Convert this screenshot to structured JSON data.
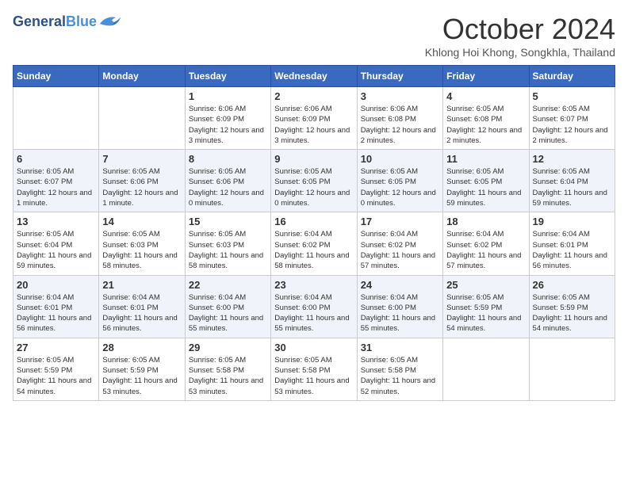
{
  "header": {
    "logo_line1": "General",
    "logo_line2": "Blue",
    "month_title": "October 2024",
    "subtitle": "Khlong Hoi Khong, Songkhla, Thailand"
  },
  "weekdays": [
    "Sunday",
    "Monday",
    "Tuesday",
    "Wednesday",
    "Thursday",
    "Friday",
    "Saturday"
  ],
  "weeks": [
    [
      {
        "day": "",
        "info": ""
      },
      {
        "day": "",
        "info": ""
      },
      {
        "day": "1",
        "info": "Sunrise: 6:06 AM\nSunset: 6:09 PM\nDaylight: 12 hours and 3 minutes."
      },
      {
        "day": "2",
        "info": "Sunrise: 6:06 AM\nSunset: 6:09 PM\nDaylight: 12 hours and 3 minutes."
      },
      {
        "day": "3",
        "info": "Sunrise: 6:06 AM\nSunset: 6:08 PM\nDaylight: 12 hours and 2 minutes."
      },
      {
        "day": "4",
        "info": "Sunrise: 6:05 AM\nSunset: 6:08 PM\nDaylight: 12 hours and 2 minutes."
      },
      {
        "day": "5",
        "info": "Sunrise: 6:05 AM\nSunset: 6:07 PM\nDaylight: 12 hours and 2 minutes."
      }
    ],
    [
      {
        "day": "6",
        "info": "Sunrise: 6:05 AM\nSunset: 6:07 PM\nDaylight: 12 hours and 1 minute."
      },
      {
        "day": "7",
        "info": "Sunrise: 6:05 AM\nSunset: 6:06 PM\nDaylight: 12 hours and 1 minute."
      },
      {
        "day": "8",
        "info": "Sunrise: 6:05 AM\nSunset: 6:06 PM\nDaylight: 12 hours and 0 minutes."
      },
      {
        "day": "9",
        "info": "Sunrise: 6:05 AM\nSunset: 6:05 PM\nDaylight: 12 hours and 0 minutes."
      },
      {
        "day": "10",
        "info": "Sunrise: 6:05 AM\nSunset: 6:05 PM\nDaylight: 12 hours and 0 minutes."
      },
      {
        "day": "11",
        "info": "Sunrise: 6:05 AM\nSunset: 6:05 PM\nDaylight: 11 hours and 59 minutes."
      },
      {
        "day": "12",
        "info": "Sunrise: 6:05 AM\nSunset: 6:04 PM\nDaylight: 11 hours and 59 minutes."
      }
    ],
    [
      {
        "day": "13",
        "info": "Sunrise: 6:05 AM\nSunset: 6:04 PM\nDaylight: 11 hours and 59 minutes."
      },
      {
        "day": "14",
        "info": "Sunrise: 6:05 AM\nSunset: 6:03 PM\nDaylight: 11 hours and 58 minutes."
      },
      {
        "day": "15",
        "info": "Sunrise: 6:05 AM\nSunset: 6:03 PM\nDaylight: 11 hours and 58 minutes."
      },
      {
        "day": "16",
        "info": "Sunrise: 6:04 AM\nSunset: 6:02 PM\nDaylight: 11 hours and 58 minutes."
      },
      {
        "day": "17",
        "info": "Sunrise: 6:04 AM\nSunset: 6:02 PM\nDaylight: 11 hours and 57 minutes."
      },
      {
        "day": "18",
        "info": "Sunrise: 6:04 AM\nSunset: 6:02 PM\nDaylight: 11 hours and 57 minutes."
      },
      {
        "day": "19",
        "info": "Sunrise: 6:04 AM\nSunset: 6:01 PM\nDaylight: 11 hours and 56 minutes."
      }
    ],
    [
      {
        "day": "20",
        "info": "Sunrise: 6:04 AM\nSunset: 6:01 PM\nDaylight: 11 hours and 56 minutes."
      },
      {
        "day": "21",
        "info": "Sunrise: 6:04 AM\nSunset: 6:01 PM\nDaylight: 11 hours and 56 minutes."
      },
      {
        "day": "22",
        "info": "Sunrise: 6:04 AM\nSunset: 6:00 PM\nDaylight: 11 hours and 55 minutes."
      },
      {
        "day": "23",
        "info": "Sunrise: 6:04 AM\nSunset: 6:00 PM\nDaylight: 11 hours and 55 minutes."
      },
      {
        "day": "24",
        "info": "Sunrise: 6:04 AM\nSunset: 6:00 PM\nDaylight: 11 hours and 55 minutes."
      },
      {
        "day": "25",
        "info": "Sunrise: 6:05 AM\nSunset: 5:59 PM\nDaylight: 11 hours and 54 minutes."
      },
      {
        "day": "26",
        "info": "Sunrise: 6:05 AM\nSunset: 5:59 PM\nDaylight: 11 hours and 54 minutes."
      }
    ],
    [
      {
        "day": "27",
        "info": "Sunrise: 6:05 AM\nSunset: 5:59 PM\nDaylight: 11 hours and 54 minutes."
      },
      {
        "day": "28",
        "info": "Sunrise: 6:05 AM\nSunset: 5:59 PM\nDaylight: 11 hours and 53 minutes."
      },
      {
        "day": "29",
        "info": "Sunrise: 6:05 AM\nSunset: 5:58 PM\nDaylight: 11 hours and 53 minutes."
      },
      {
        "day": "30",
        "info": "Sunrise: 6:05 AM\nSunset: 5:58 PM\nDaylight: 11 hours and 53 minutes."
      },
      {
        "day": "31",
        "info": "Sunrise: 6:05 AM\nSunset: 5:58 PM\nDaylight: 11 hours and 52 minutes."
      },
      {
        "day": "",
        "info": ""
      },
      {
        "day": "",
        "info": ""
      }
    ]
  ]
}
